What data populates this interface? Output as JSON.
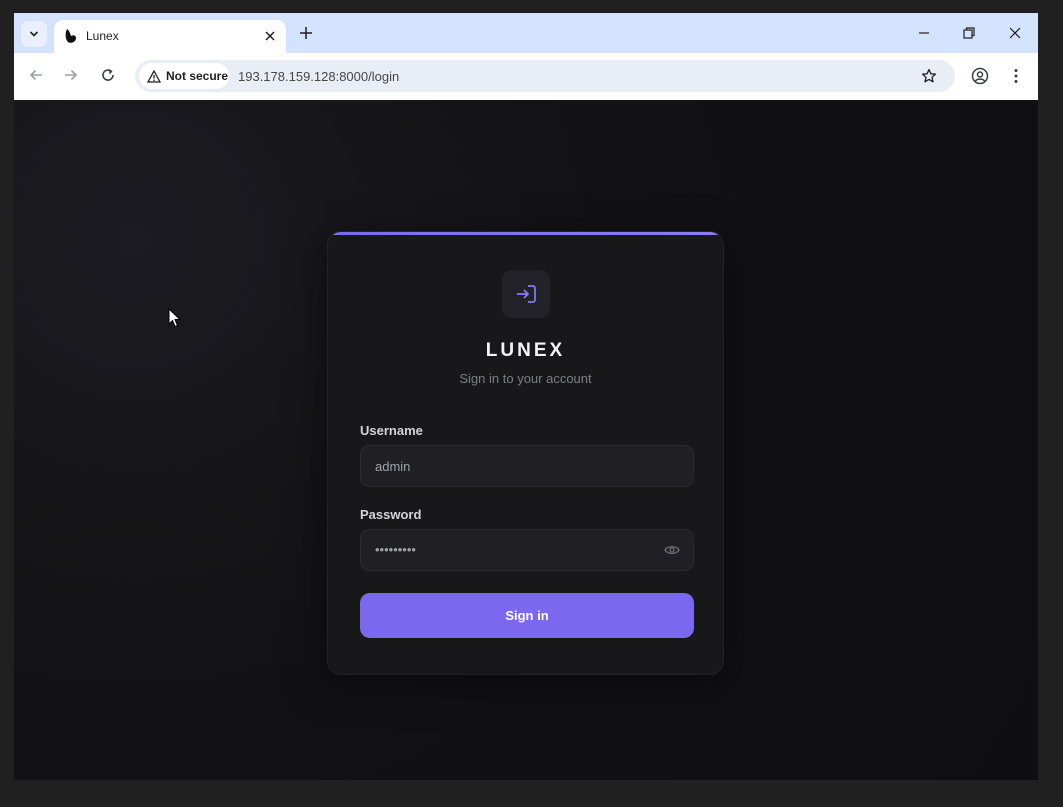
{
  "browser": {
    "tab_title": "Lunex",
    "security_label": "Not secure",
    "url": "193.178.159.128:8000/login"
  },
  "login": {
    "brand": "LUNEX",
    "subtitle": "Sign in to your account",
    "username_label": "Username",
    "username_value": "admin",
    "password_label": "Password",
    "password_masked": "•••••••••",
    "submit_label": "Sign in"
  },
  "colors": {
    "accent": "#7b68ee",
    "card_bg": "#18181b",
    "page_bg": "#111113",
    "tabstrip_bg": "#d3e3fd"
  },
  "icons": [
    "tab-search-icon",
    "favicon-icon",
    "close-icon",
    "plus-icon",
    "minimize-icon",
    "restore-icon",
    "back-icon",
    "forward-icon",
    "reload-icon",
    "warning-icon",
    "star-icon",
    "profile-icon",
    "menu-icon",
    "login-icon",
    "eye-icon"
  ]
}
